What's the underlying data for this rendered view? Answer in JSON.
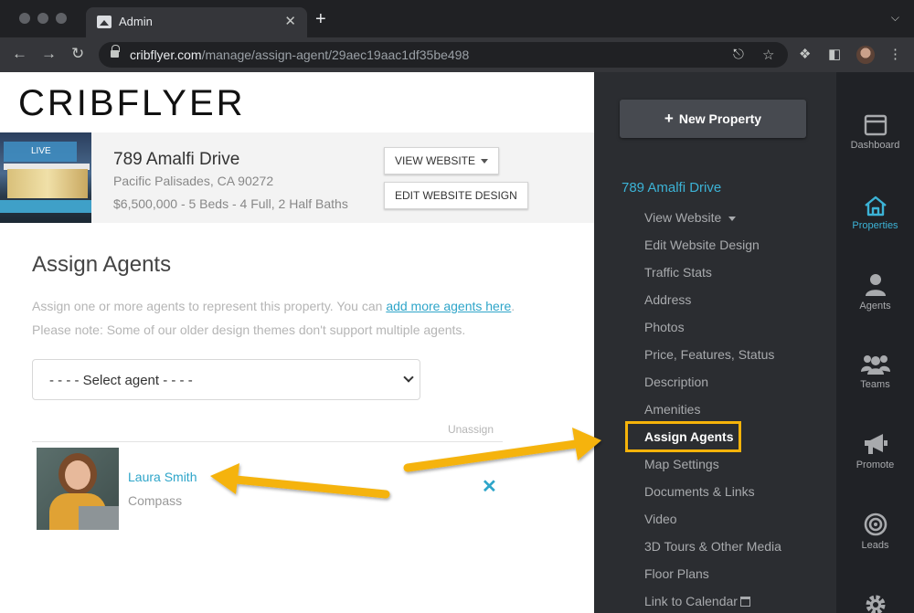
{
  "browser": {
    "tab_title": "Admin",
    "tab_close": "✕",
    "new_tab": "+",
    "url_host": "cribflyer.com",
    "url_path": "/manage/assign-agent/29aec19aac1df35be498"
  },
  "brand": {
    "logo": "CRIBFLYER"
  },
  "property": {
    "badge": "LIVE",
    "title": "789 Amalfi Drive",
    "address": "Pacific Palisades, CA 90272",
    "meta": "$6,500,000 - 5 Beds - 4 Full, 2 Half Baths",
    "view_website_label": "VIEW WEBSITE",
    "edit_design_label": "EDIT WEBSITE DESIGN"
  },
  "assign": {
    "heading": "Assign Agents",
    "help_prefix": "Assign one or more agents to represent this property. You can ",
    "help_link": "add more agents here",
    "help_suffix": ".",
    "help_note": "Please note: Some of our older design themes don't support multiple agents.",
    "select_value": "- - - - Select agent - - - -",
    "column_unassign": "Unassign",
    "agents": [
      {
        "name": "Laura Smith",
        "company": "Compass",
        "unassign_symbol": "✕"
      }
    ]
  },
  "sidebar": {
    "new_property_label": "New Property",
    "property_title": "789 Amalfi Drive",
    "items": [
      {
        "label": "View Website"
      },
      {
        "label": "Edit Website Design"
      },
      {
        "label": "Traffic Stats"
      },
      {
        "label": "Address"
      },
      {
        "label": "Photos"
      },
      {
        "label": "Price, Features, Status"
      },
      {
        "label": "Description"
      },
      {
        "label": "Amenities"
      },
      {
        "label": "Assign Agents",
        "active": true
      },
      {
        "label": "Map Settings"
      },
      {
        "label": "Documents & Links"
      },
      {
        "label": "Video"
      },
      {
        "label": "3D Tours & Other Media"
      },
      {
        "label": "Floor Plans"
      },
      {
        "label": "Link to Calendar"
      }
    ]
  },
  "rail": {
    "items": [
      {
        "label": "Dashboard",
        "icon": "window-icon"
      },
      {
        "label": "Properties",
        "icon": "house-icon",
        "active": true
      },
      {
        "label": "Agents",
        "icon": "person-icon"
      },
      {
        "label": "Teams",
        "icon": "group-icon"
      },
      {
        "label": "Promote",
        "icon": "megaphone-icon"
      },
      {
        "label": "Leads",
        "icon": "target-icon"
      },
      {
        "label": "",
        "icon": "gear-icon"
      }
    ]
  },
  "colors": {
    "accent": "#3cb3d6",
    "highlight": "#f5b30a",
    "sidebar_bg": "#2b2d31",
    "rail_bg": "#202226"
  }
}
